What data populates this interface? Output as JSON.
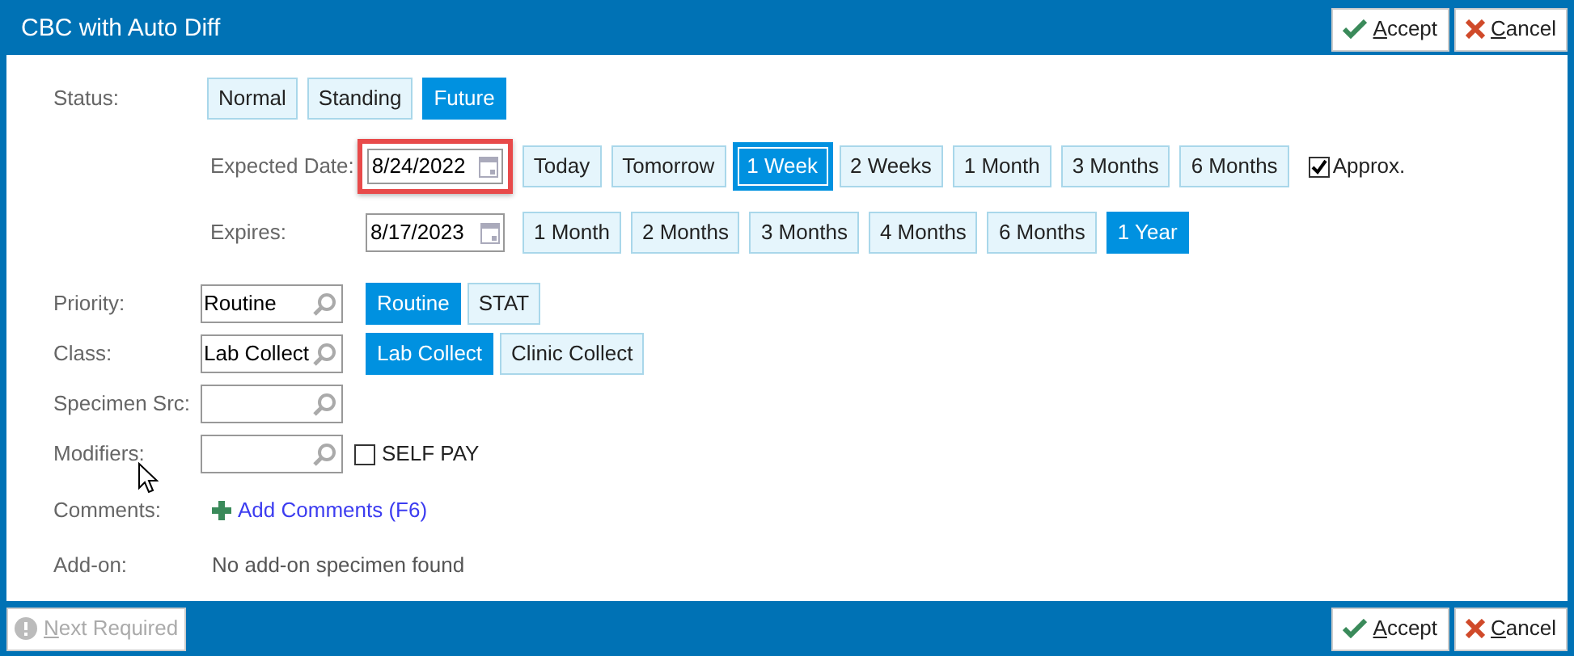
{
  "window": {
    "title": "CBC with Auto Diff"
  },
  "header_buttons": [
    {
      "kind": "accept",
      "label": "Accept"
    },
    {
      "kind": "cancel",
      "label": "Cancel"
    }
  ],
  "status": {
    "label": "Status:",
    "options": [
      {
        "label": "Normal",
        "selected": false
      },
      {
        "label": "Standing",
        "selected": false
      },
      {
        "label": "Future",
        "selected": true
      }
    ]
  },
  "expected_date": {
    "label": "Expected Date:",
    "value": "8/24/2022",
    "highlighted": true,
    "options": [
      {
        "label": "Today",
        "selected": false,
        "focused": false
      },
      {
        "label": "Tomorrow",
        "selected": false,
        "focused": false
      },
      {
        "label": "1 Week",
        "selected": true,
        "focused": true
      },
      {
        "label": "2 Weeks",
        "selected": false,
        "focused": false
      },
      {
        "label": "1 Month",
        "selected": false,
        "focused": false
      },
      {
        "label": "3 Months",
        "selected": false,
        "focused": false
      },
      {
        "label": "6 Months",
        "selected": false,
        "focused": false
      }
    ],
    "approx": {
      "label": "Approx.",
      "checked": true
    }
  },
  "expires": {
    "label": "Expires:",
    "value": "8/17/2023",
    "options": [
      {
        "label": "1 Month",
        "selected": false
      },
      {
        "label": "2 Months",
        "selected": false
      },
      {
        "label": "3 Months",
        "selected": false
      },
      {
        "label": "4 Months",
        "selected": false
      },
      {
        "label": "6 Months",
        "selected": false
      },
      {
        "label": "1 Year",
        "selected": true
      }
    ]
  },
  "fields": [
    {
      "label": "Priority:",
      "value": "Routine",
      "options": [
        {
          "label": "Routine",
          "selected": true
        },
        {
          "label": "STAT",
          "selected": false
        }
      ]
    },
    {
      "label": "Class:",
      "value": "Lab Collect",
      "options": [
        {
          "label": "Lab Collect",
          "selected": true
        },
        {
          "label": "Clinic Collect",
          "selected": false
        }
      ]
    },
    {
      "label": "Specimen Src:"
    },
    {
      "label": "Modifiers:",
      "checkbox": {
        "label": "SELF PAY",
        "checked": false
      }
    }
  ],
  "comments": {
    "label": "Comments:",
    "link": "Add Comments (F6)"
  },
  "addon": {
    "label": "Add-on:",
    "text": "No add-on specimen found"
  },
  "footer": {
    "next_button": {
      "label": "Next Required",
      "disabled": true
    },
    "buttons": [
      {
        "kind": "accept",
        "label": "Accept"
      },
      {
        "kind": "cancel",
        "label": "Cancel"
      }
    ]
  }
}
